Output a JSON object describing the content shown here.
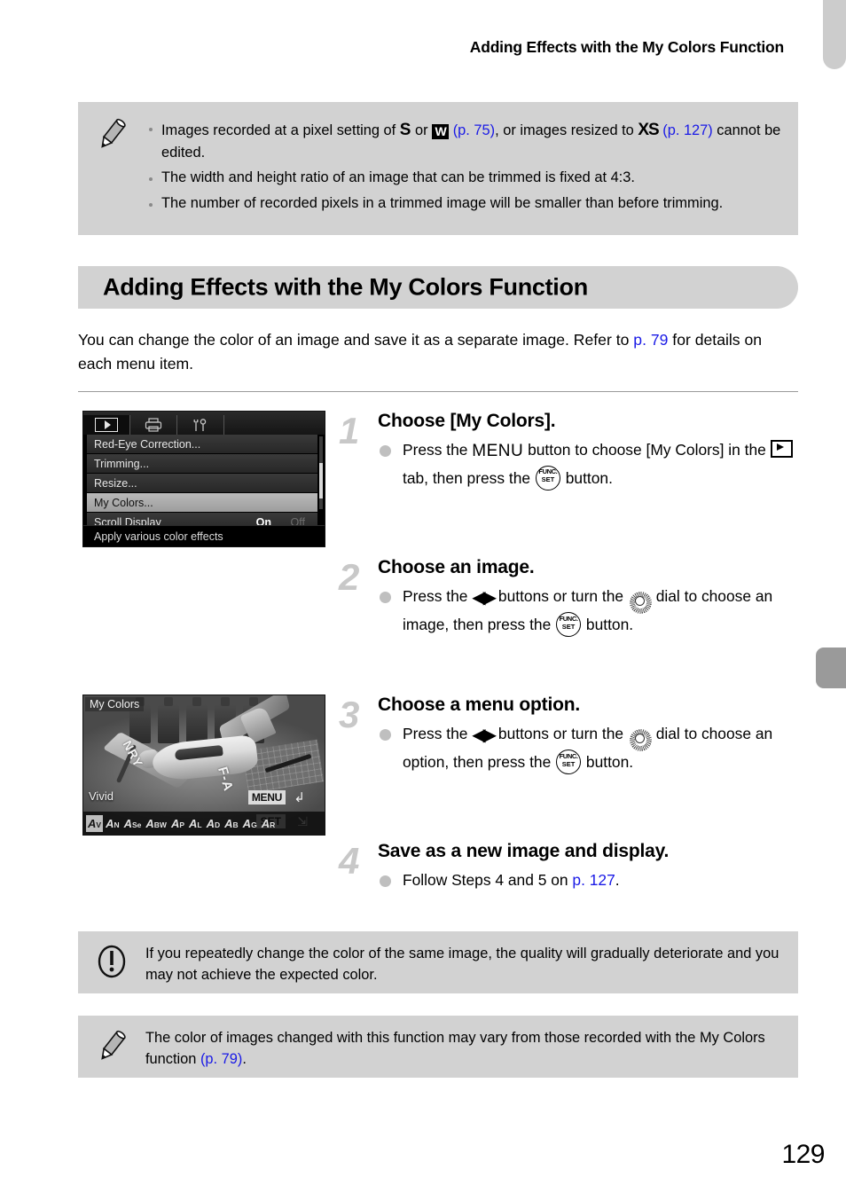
{
  "header": {
    "running_title": "Adding Effects with the My Colors Function"
  },
  "top_note": {
    "icon": "pencil-icon",
    "bullets": [
      {
        "parts": [
          {
            "t": "text",
            "v": "Images recorded at a pixel setting of "
          },
          {
            "t": "glyph-s",
            "v": "S"
          },
          {
            "t": "text",
            "v": " or "
          },
          {
            "t": "glyph-w",
            "v": "W"
          },
          {
            "t": "link",
            "v": " (p. 75)"
          },
          {
            "t": "text",
            "v": ", or images resized to "
          },
          {
            "t": "glyph-xs",
            "v": "XS"
          },
          {
            "t": "link",
            "v": " (p. 127)"
          },
          {
            "t": "text",
            "v": " cannot be edited."
          }
        ]
      },
      {
        "parts": [
          {
            "t": "text",
            "v": "The width and height ratio of an image that can be trimmed is fixed at 4:3."
          }
        ]
      },
      {
        "parts": [
          {
            "t": "text",
            "v": "The number of recorded pixels in a trimmed image will be smaller than before trimming."
          }
        ]
      }
    ]
  },
  "section": {
    "title": "Adding Effects with the My Colors Function",
    "intro_pre": "You can change the color of an image and save it as a separate image. Refer to ",
    "intro_link": "p. 79",
    "intro_post": " for details on each menu item."
  },
  "menu_screen": {
    "tabs": [
      {
        "name": "playback-tab",
        "icon": "playback-icon",
        "active": true
      },
      {
        "name": "print-tab",
        "icon": "printer-icon",
        "active": false
      },
      {
        "name": "settings-tab",
        "icon": "tools-icon",
        "active": false
      }
    ],
    "rows": [
      {
        "label": "Red-Eye Correction...",
        "value_on": "",
        "value_off": "",
        "selected": false
      },
      {
        "label": "Trimming...",
        "value_on": "",
        "value_off": "",
        "selected": false
      },
      {
        "label": "Resize...",
        "value_on": "",
        "value_off": "",
        "selected": false
      },
      {
        "label": "My Colors...",
        "value_on": "",
        "value_off": "",
        "selected": true
      },
      {
        "label": "Scroll Display",
        "value_on": "On",
        "value_off": "Off",
        "selected": false
      }
    ],
    "hint": "Apply various color effects"
  },
  "photo_screen": {
    "label": "My Colors",
    "mode": "Vivid",
    "menu_button": "MENU",
    "set_button": "SET",
    "mycolors_options": [
      {
        "letter": "A",
        "sub": "V",
        "active": true
      },
      {
        "letter": "A",
        "sub": "N",
        "active": false
      },
      {
        "letter": "A",
        "sub": "Se",
        "active": false
      },
      {
        "letter": "A",
        "sub": "BW",
        "active": false
      },
      {
        "letter": "A",
        "sub": "P",
        "active": false
      },
      {
        "letter": "A",
        "sub": "L",
        "active": false
      },
      {
        "letter": "A",
        "sub": "D",
        "active": false
      },
      {
        "letter": "A",
        "sub": "B",
        "active": false
      },
      {
        "letter": "A",
        "sub": "G",
        "active": false
      },
      {
        "letter": "A",
        "sub": "R",
        "active": false
      }
    ],
    "plane_marking_left": "NRY",
    "plane_marking_right": "F-A"
  },
  "steps": [
    {
      "number": "1",
      "title": "Choose [My Colors].",
      "body_parts": [
        {
          "t": "text",
          "v": "Press the "
        },
        {
          "t": "menu-icon",
          "v": "MENU"
        },
        {
          "t": "text",
          "v": " button to choose [My Colors] in the "
        },
        {
          "t": "play-icon",
          "v": ""
        },
        {
          "t": "text",
          "v": " tab, then press the "
        },
        {
          "t": "func-icon",
          "v": "FUNC/SET"
        },
        {
          "t": "text",
          "v": " button."
        }
      ]
    },
    {
      "number": "2",
      "title": "Choose an image.",
      "body_parts": [
        {
          "t": "text",
          "v": "Press the "
        },
        {
          "t": "lr-icon",
          "v": "◀▶"
        },
        {
          "t": "text",
          "v": " buttons or turn the "
        },
        {
          "t": "dial-icon",
          "v": ""
        },
        {
          "t": "text",
          "v": " dial to choose an image, then press the "
        },
        {
          "t": "func-icon",
          "v": "FUNC/SET"
        },
        {
          "t": "text",
          "v": " button."
        }
      ]
    },
    {
      "number": "3",
      "title": "Choose a menu option.",
      "body_parts": [
        {
          "t": "text",
          "v": "Press the "
        },
        {
          "t": "lr-icon",
          "v": "◀▶"
        },
        {
          "t": "text",
          "v": " buttons or turn the "
        },
        {
          "t": "dial-icon",
          "v": ""
        },
        {
          "t": "text",
          "v": " dial to choose an option, then press the "
        },
        {
          "t": "func-icon",
          "v": "FUNC/SET"
        },
        {
          "t": "text",
          "v": " button."
        }
      ]
    },
    {
      "number": "4",
      "title": "Save as a new image and display.",
      "body_parts": [
        {
          "t": "text",
          "v": "Follow Steps 4 and 5 on "
        },
        {
          "t": "link",
          "v": "p. 127"
        },
        {
          "t": "text",
          "v": "."
        }
      ]
    }
  ],
  "caution_note": {
    "icon": "exclamation-icon",
    "text": "If you repeatedly change the color of the same image, the quality will gradually deteriorate and you may not achieve the expected color."
  },
  "bottom_note": {
    "icon": "pencil-icon",
    "text_pre": "The color of images changed with this function may vary from those recorded with the My Colors function ",
    "link": "(p. 79)",
    "text_post": "."
  },
  "footer": {
    "page_number": "129"
  },
  "colors": {
    "note_bg": "#d2d2d2",
    "link": "#1a1ae6",
    "step_number": "#c8c8c8",
    "bullet": "#bfbfbf",
    "edge_tab": "#9a9a9a"
  }
}
